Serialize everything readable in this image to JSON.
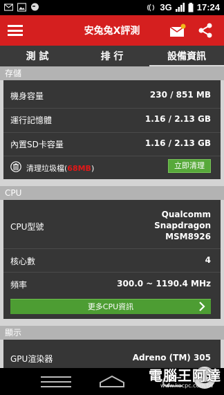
{
  "status_bar": {
    "network": "3G",
    "time": "17:24"
  },
  "app_bar": {
    "title": "安兔兔X評測",
    "menu_icon": "menu-icon",
    "mail_icon": "mail-icon",
    "share_icon": "share-icon"
  },
  "tabs": [
    {
      "label": "測 試"
    },
    {
      "label": "排 行"
    },
    {
      "label": "設備資訊",
      "selected": true
    }
  ],
  "storage": {
    "header": "存儲",
    "rows": [
      {
        "label": "機身容量",
        "value": "230 / 851 MB"
      },
      {
        "label": "運行記憶體",
        "value": "1.16 / 2.13 GB"
      },
      {
        "label": "內置SD卡容量",
        "value": "1.16 / 2.13 GB"
      }
    ],
    "clean": {
      "label": "清理垃圾檔",
      "size_open": "(",
      "size": "68MB",
      "size_close": ")",
      "button": "立即清理"
    }
  },
  "cpu": {
    "header": "CPU",
    "model_label": "CPU型號",
    "model_lines": [
      "Qualcomm",
      "Snapdragon",
      "MSM8926"
    ],
    "cores_label": "核心數",
    "cores_value": "4",
    "freq_label": "頻率",
    "freq_value": "300.0 ~ 1190.4 MHz",
    "more_button": "更多CPU資訊"
  },
  "display": {
    "header": "顯示",
    "gpu_label": "GPU渲染器",
    "gpu_value": "Adreno (TM) 305"
  },
  "watermark": {
    "text": "電腦王阿達",
    "url": "www.kocpc.com.tw"
  },
  "colors": {
    "app_bar": "#d51f1f",
    "tabs": "#3a3a3a",
    "card": "#363636",
    "section_header": "#b3b3b3",
    "button_green": "#57a93a",
    "highlight_red": "#e01818"
  }
}
